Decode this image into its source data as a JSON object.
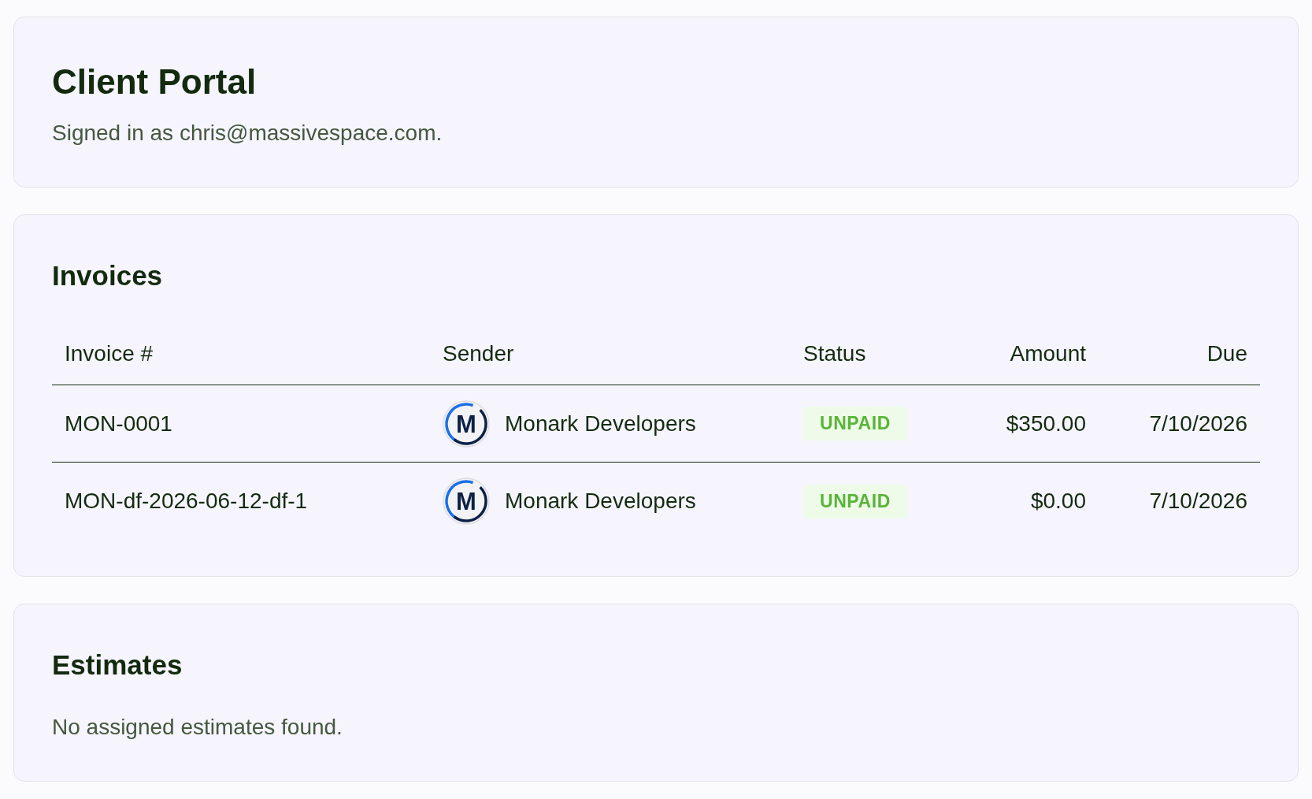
{
  "header": {
    "title": "Client Portal",
    "subtitle": "Signed in as chris@massivespace.com."
  },
  "invoices": {
    "title": "Invoices",
    "columns": [
      "Invoice #",
      "Sender",
      "Status",
      "Amount",
      "Due"
    ],
    "rows": [
      {
        "invoice_number": "MON-0001",
        "sender": {
          "logo_text": "M",
          "name": "Monark Developers"
        },
        "status": "UNPAID",
        "amount": "$350.00",
        "due": "7/10/2026"
      },
      {
        "invoice_number": "MON-df-2026-06-12-df-1",
        "sender": {
          "logo_text": "M",
          "name": "Monark Developers"
        },
        "status": "UNPAID",
        "amount": "$0.00",
        "due": "7/10/2026"
      }
    ]
  },
  "estimates": {
    "title": "Estimates",
    "empty_message": "No assigned estimates found."
  }
}
